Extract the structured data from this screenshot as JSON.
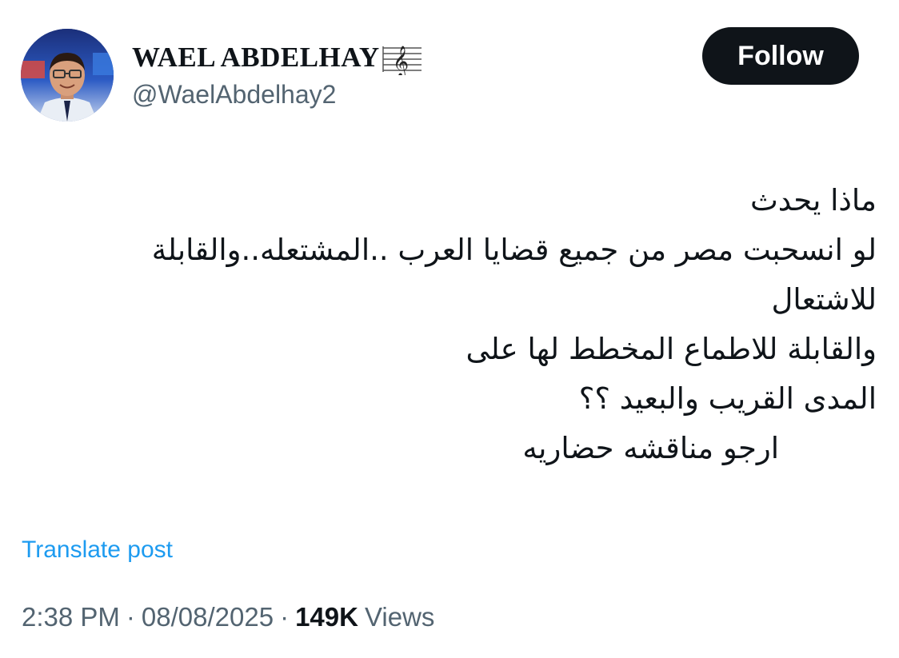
{
  "author": {
    "display_name": "WAEL ABDELHAY",
    "badge_icon": "music-staff-icon",
    "handle": "@WaelAbdelhay2"
  },
  "follow_button": {
    "label": "Follow"
  },
  "post": {
    "lines": [
      "ماذا يحدث",
      "لو انسحبت مصر من جميع قضايا العرب ..المشتعله..والقابلة",
      "للاشتعال",
      "والقابلة للاطماع المخطط لها على",
      "المدى القريب والبعيد ؟؟",
      "ارجو مناقشه حضاريه"
    ]
  },
  "translate": {
    "label": "Translate post"
  },
  "meta": {
    "time": "2:38 PM",
    "separator": "·",
    "date": "08/08/2025",
    "views_count": "149K",
    "views_label": "Views"
  },
  "colors": {
    "text_primary": "#0f1419",
    "text_secondary": "#536471",
    "link": "#1d9bf0",
    "button_bg": "#0f1419",
    "button_text": "#ffffff"
  }
}
